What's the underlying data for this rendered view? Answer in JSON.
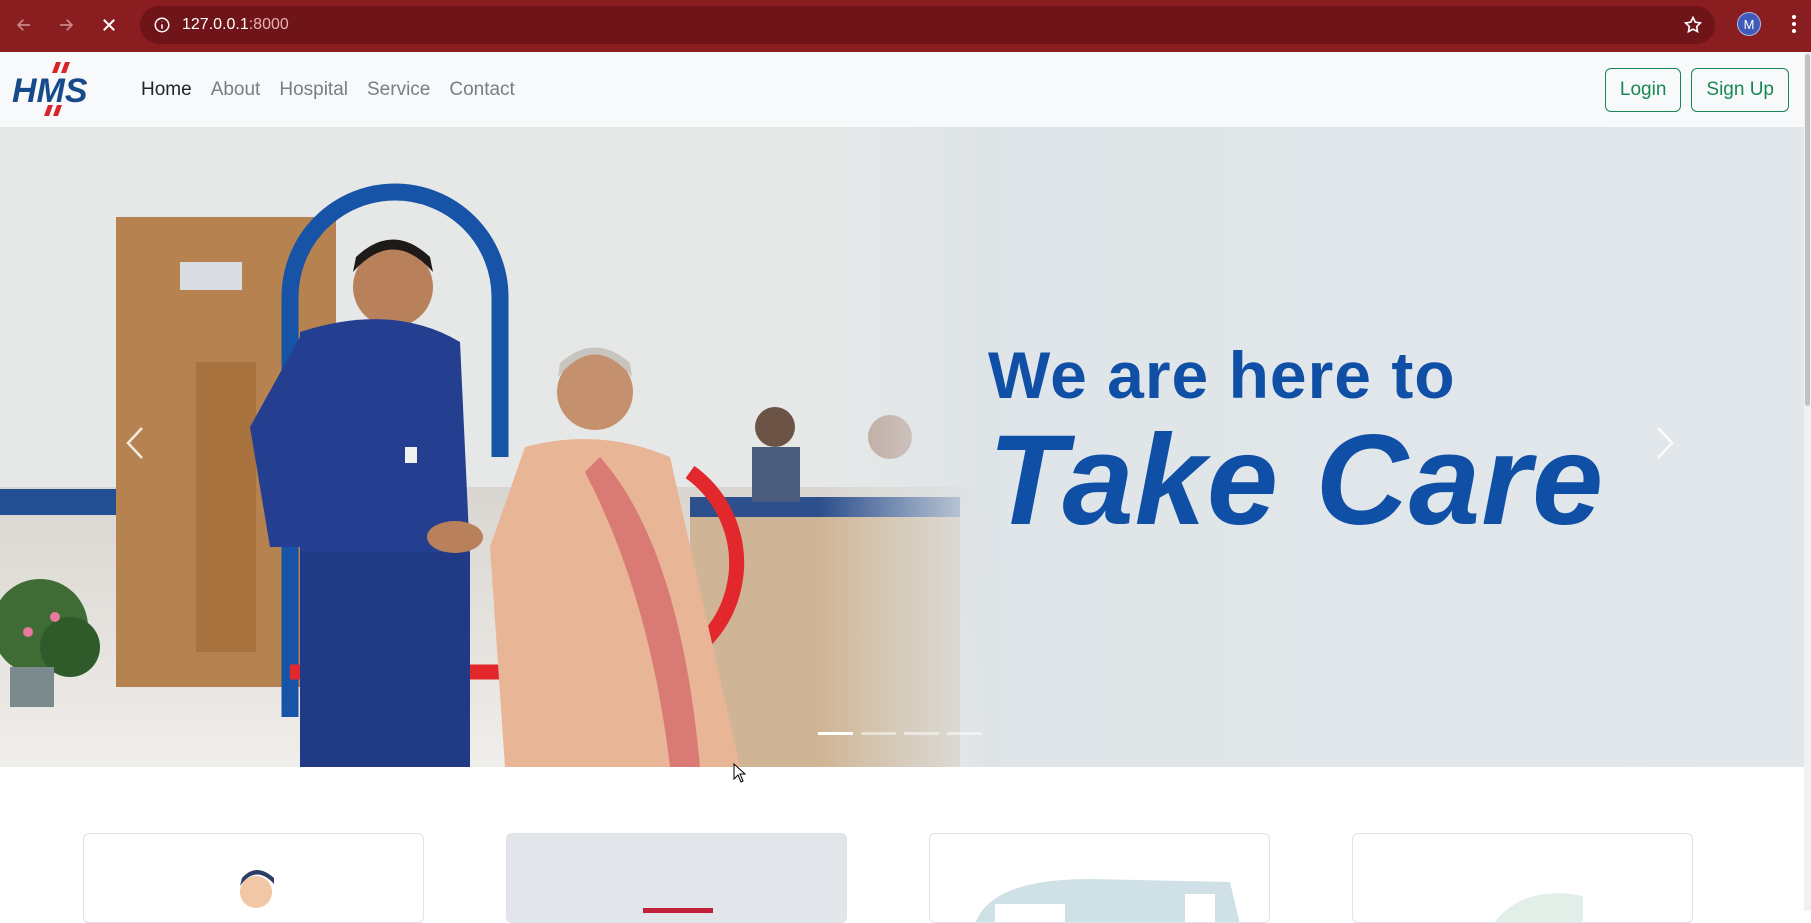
{
  "browser": {
    "url_host": "127.0.0.1",
    "url_port": ":8000",
    "profile_initial": "M",
    "icons": [
      "back-arrow-icon",
      "forward-arrow-icon",
      "stop-loading-icon",
      "site-info-icon",
      "bookmark-star-icon",
      "kebab-menu-icon"
    ]
  },
  "navbar": {
    "logo_text": "HMS",
    "links": [
      {
        "label": "Home",
        "active": true
      },
      {
        "label": "About",
        "active": false
      },
      {
        "label": "Hospital",
        "active": false
      },
      {
        "label": "Service",
        "active": false
      },
      {
        "label": "Contact",
        "active": false
      }
    ],
    "login_label": "Login",
    "signup_label": "Sign Up"
  },
  "hero": {
    "line1": "We are here to",
    "line2": "Take Care",
    "slides": 4,
    "active_slide": 1,
    "text_color": "#0f50a6"
  },
  "cards": [
    {
      "style": "white"
    },
    {
      "style": "grey"
    },
    {
      "style": "white"
    },
    {
      "style": "white"
    }
  ],
  "colors": {
    "browser_bar": "#891d20",
    "accent_green": "#198754",
    "hero_blue": "#0f50a6",
    "hero_red": "#e23b3b"
  }
}
